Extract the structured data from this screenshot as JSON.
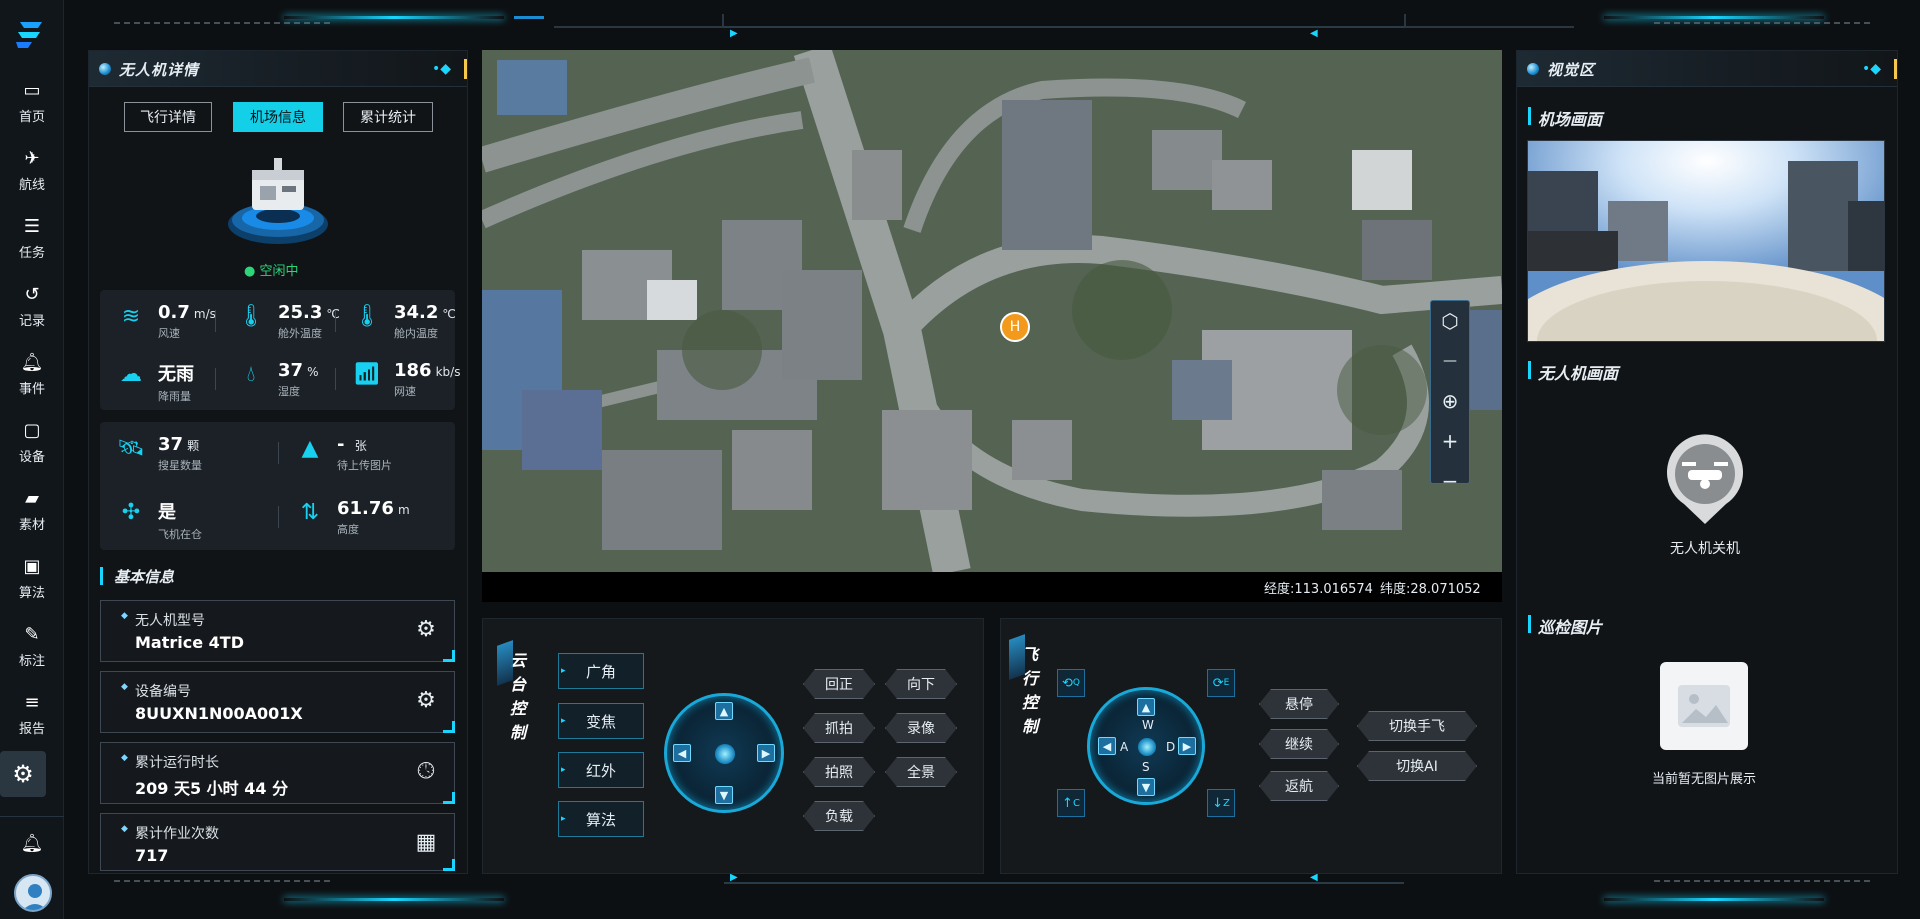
{
  "nav": {
    "items": [
      {
        "label": "首页",
        "icon": "monitor-icon"
      },
      {
        "label": "航线",
        "icon": "plane-icon"
      },
      {
        "label": "任务",
        "icon": "task-icon"
      },
      {
        "label": "记录",
        "icon": "history-icon"
      },
      {
        "label": "事件",
        "icon": "bell-icon"
      },
      {
        "label": "设备",
        "icon": "device-icon"
      },
      {
        "label": "素材",
        "icon": "folder-icon"
      },
      {
        "label": "算法",
        "icon": "algorithm-icon"
      },
      {
        "label": "标注",
        "icon": "annotate-icon"
      },
      {
        "label": "报告",
        "icon": "report-icon"
      }
    ]
  },
  "left_panel": {
    "title": "无人机详情",
    "tabs": [
      "飞行详情",
      "机场信息",
      "累计统计"
    ],
    "active_tab": "机场信息",
    "dock_status": "空闲中",
    "weather": [
      {
        "value": "0.7",
        "unit": "m/s",
        "label": "风速",
        "icon": "wind-icon"
      },
      {
        "value": "25.3",
        "unit": "℃",
        "label": "舱外温度",
        "icon": "thermometer-icon"
      },
      {
        "value": "34.2",
        "unit": "℃",
        "label": "舱内温度",
        "icon": "thermometer-icon"
      },
      {
        "value": "无雨",
        "unit": "",
        "label": "降雨量",
        "icon": "rain-icon"
      },
      {
        "value": "37",
        "unit": "%",
        "label": "湿度",
        "icon": "humidity-icon"
      },
      {
        "value": "186",
        "unit": "kb/s",
        "label": "网速",
        "icon": "wifi-icon"
      }
    ],
    "status": [
      {
        "value": "37",
        "unit": "颗",
        "label": "搜星数量",
        "icon": "satellite-icon"
      },
      {
        "value": "- ",
        "unit": "张",
        "label": "待上传图片",
        "icon": "upload-image-icon"
      },
      {
        "value": "是",
        "unit": "",
        "label": "飞机在仓",
        "icon": "drone-icon"
      },
      {
        "value": "61.76",
        "unit": "m",
        "label": "高度",
        "icon": "altitude-icon"
      }
    ],
    "basic_title": "基本信息",
    "basic_info": [
      {
        "label": "无人机型号",
        "value": "Matrice 4TD",
        "icon": "drone-settings-icon"
      },
      {
        "label": "设备编号",
        "value": "8UUXN1N00A001X",
        "icon": "drone-settings-icon"
      },
      {
        "label": "累计运行时长",
        "value": "209 天5 小时 44 分",
        "icon": "clock-icon"
      },
      {
        "label": "累计作业次数",
        "value": "717",
        "icon": "calendar-icon"
      }
    ]
  },
  "map": {
    "home_marker": "H",
    "longitude": "经度:113.016574",
    "latitude": "纬度:28.071052"
  },
  "gimbal": {
    "title_chars": [
      "云",
      "台",
      "控",
      "制"
    ],
    "side_buttons": [
      "广角",
      "变焦",
      "红外",
      "算法"
    ],
    "action_buttons": [
      "回正",
      "向下",
      "抓拍",
      "录像",
      "拍照",
      "全景",
      "负载"
    ]
  },
  "flight": {
    "title_chars": [
      "飞",
      "行",
      "控",
      "制"
    ],
    "keys": {
      "w": "W",
      "a": "A",
      "s": "S",
      "d": "D"
    },
    "corner_icons": {
      "c_label": "C",
      "z_label": "Z",
      "q_label": "Q",
      "e_label": "E"
    },
    "actions": [
      "悬停",
      "继续",
      "返航"
    ],
    "switch_buttons": [
      "切换手飞",
      "切换AI"
    ]
  },
  "right_panel": {
    "title": "视觉区",
    "dock_view_title": "机场画面",
    "drone_view_title": "无人机画面",
    "drone_status": "无人机关机",
    "patrol_title": "巡检图片",
    "no_images": "当前暂无图片展示"
  },
  "colors": {
    "accent": "#19d6ff",
    "active_tab": "#14cfe8",
    "status_green": "#2fd37a",
    "marker": "#f39a1c"
  }
}
